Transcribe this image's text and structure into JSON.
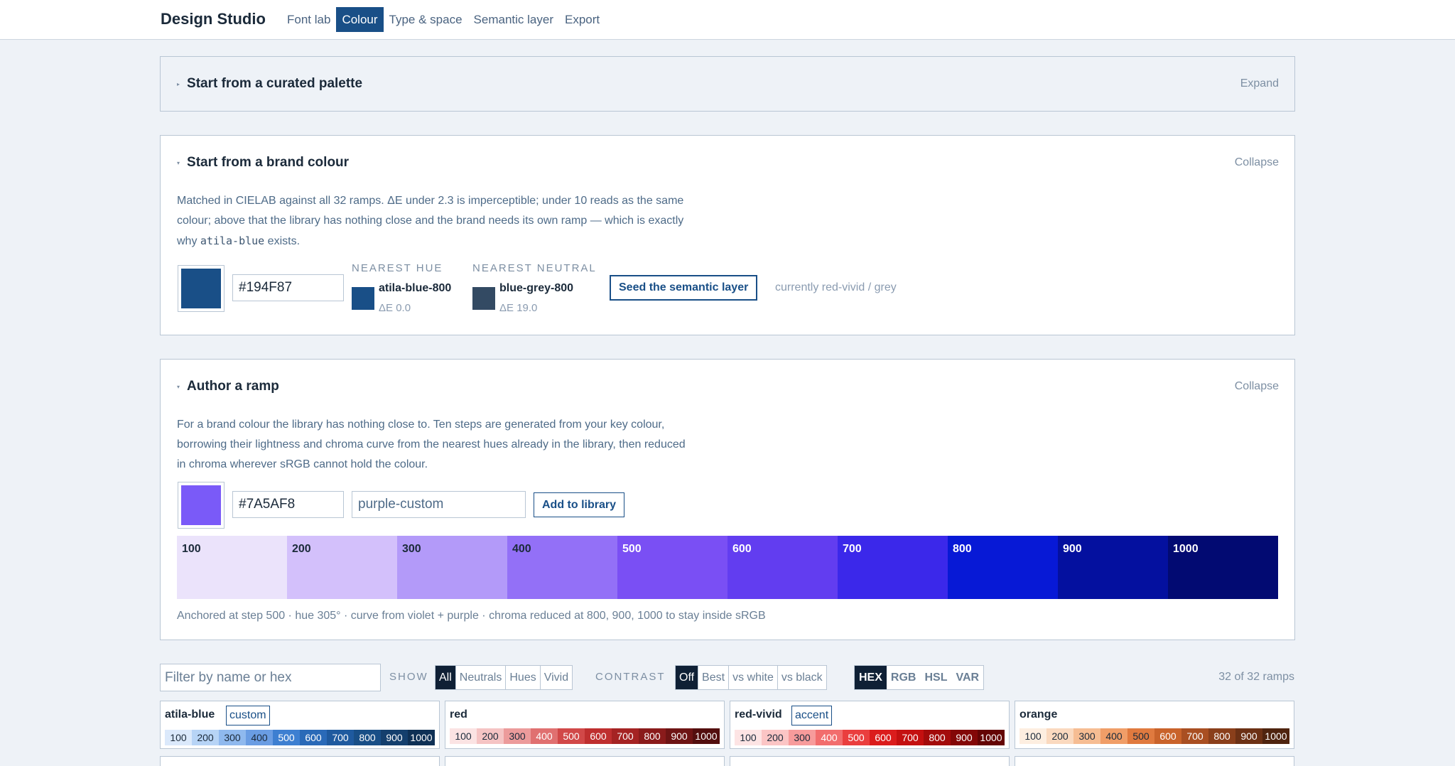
{
  "app": {
    "title": "Design Studio"
  },
  "nav": [
    {
      "label": "Font lab",
      "active": false
    },
    {
      "label": "Colour",
      "active": true
    },
    {
      "label": "Type & space",
      "active": false
    },
    {
      "label": "Semantic layer",
      "active": false
    },
    {
      "label": "Export",
      "active": false
    }
  ],
  "curated": {
    "title": "Start from a curated palette",
    "toggle": "Expand"
  },
  "brand": {
    "title": "Start from a brand colour",
    "toggle": "Collapse",
    "desc_1": "Matched in CIELAB against all 32 ramps. ΔE under 2.3 is imperceptible; under 10 reads as the same colour; above that the library has nothing close and the brand needs its own ramp — which is exactly why ",
    "desc_code": "atila-blue",
    "desc_2": " exists.",
    "hex": "#194F87",
    "nearest_hue_label": "NEAREST HUE",
    "nearest_hue_name": "atila-blue-800",
    "nearest_hue_de": "ΔE 0.0",
    "nearest_hue_color": "#194f87",
    "nearest_neutral_label": "NEAREST NEUTRAL",
    "nearest_neutral_name": "blue-grey-800",
    "nearest_neutral_de": "ΔE 19.0",
    "nearest_neutral_color": "#334a63",
    "seed_button": "Seed the semantic layer",
    "current": "currently red-vivid / grey"
  },
  "author": {
    "title": "Author a ramp",
    "toggle": "Collapse",
    "desc": "For a brand colour the library has nothing close to. Ten steps are generated from your key colour, borrowing their lightness and chroma curve from the nearest hues already in the library, then reduced in chroma wherever sRGB cannot hold the colour.",
    "hex": "#7A5AF8",
    "name": "purple-custom",
    "add_button": "Add to library",
    "steps": [
      {
        "label": "100",
        "color": "#ebe3fb",
        "text": "#1b2a3a"
      },
      {
        "label": "200",
        "color": "#d3c0fb",
        "text": "#1b2a3a"
      },
      {
        "label": "300",
        "color": "#b39af9",
        "text": "#1b2a3a"
      },
      {
        "label": "400",
        "color": "#9370f7",
        "text": "#1b2a3a"
      },
      {
        "label": "500",
        "color": "#7a4ff4",
        "text": "#ffffff"
      },
      {
        "label": "600",
        "color": "#623df0",
        "text": "#ffffff"
      },
      {
        "label": "700",
        "color": "#3b28ea",
        "text": "#ffffff"
      },
      {
        "label": "800",
        "color": "#0719d6",
        "text": "#ffffff"
      },
      {
        "label": "900",
        "color": "#04109f",
        "text": "#ffffff"
      },
      {
        "label": "1000",
        "color": "#020a72",
        "text": "#ffffff"
      }
    ],
    "anchored": "Anchored at step 500 · hue 305° · curve from violet + purple · chroma reduced at 800, 900, 1000 to stay inside sRGB"
  },
  "library": {
    "filter_placeholder": "Filter by name or hex",
    "show_label": "SHOW",
    "show_options": [
      "All",
      "Neutrals",
      "Hues",
      "Vivid"
    ],
    "contrast_label": "CONTRAST",
    "contrast_options": [
      "Off",
      "Best",
      "vs white",
      "vs black"
    ],
    "format_options": [
      "HEX",
      "RGB",
      "HSL",
      "VAR"
    ],
    "count": "32 of 32 ramps",
    "cards": [
      {
        "name": "atila-blue",
        "tag": "custom",
        "steps": [
          "100",
          "200",
          "300",
          "400",
          "500",
          "600",
          "700",
          "800",
          "900",
          "1000"
        ],
        "colors": [
          "#dbe9fb",
          "#b7d4f6",
          "#8fb9ee",
          "#6a9de3",
          "#3d7fd1",
          "#2a6ab8",
          "#1f5a9f",
          "#194f87",
          "#143f6d",
          "#0e3055"
        ],
        "texts": [
          "#1b2a3a",
          "#1b2a3a",
          "#1b2a3a",
          "#1b2a3a",
          "#ffffff",
          "#ffffff",
          "#ffffff",
          "#ffffff",
          "#ffffff",
          "#ffffff"
        ]
      },
      {
        "name": "red",
        "tag": "",
        "steps": [
          "100",
          "200",
          "300",
          "400",
          "500",
          "600",
          "700",
          "800",
          "900",
          "1000"
        ],
        "colors": [
          "#fbe3e3",
          "#f5c4c4",
          "#ec9b9b",
          "#e07070",
          "#d14848",
          "#bf2f2f",
          "#a52323",
          "#8a1b1b",
          "#6e1414",
          "#530e0e"
        ],
        "texts": [
          "#1b2a3a",
          "#1b2a3a",
          "#1b2a3a",
          "#ffffff",
          "#ffffff",
          "#ffffff",
          "#ffffff",
          "#ffffff",
          "#ffffff",
          "#ffffff"
        ]
      },
      {
        "name": "red-vivid",
        "tag": "accent",
        "steps": [
          "100",
          "200",
          "300",
          "400",
          "500",
          "600",
          "700",
          "800",
          "900",
          "1000"
        ],
        "colors": [
          "#fde4e4",
          "#fbc5c5",
          "#f79b9b",
          "#f26d6d",
          "#ea3e3e",
          "#db1c1c",
          "#c41010",
          "#a30b0b",
          "#830707",
          "#640404"
        ],
        "texts": [
          "#1b2a3a",
          "#1b2a3a",
          "#1b2a3a",
          "#ffffff",
          "#ffffff",
          "#ffffff",
          "#ffffff",
          "#ffffff",
          "#ffffff",
          "#ffffff"
        ]
      },
      {
        "name": "orange",
        "tag": "",
        "steps": [
          "100",
          "200",
          "300",
          "400",
          "500",
          "600",
          "700",
          "800",
          "900",
          "1000"
        ],
        "colors": [
          "#fdeee0",
          "#fad9bf",
          "#f6bd93",
          "#f09e68",
          "#e07a3f",
          "#c9632b",
          "#a94f22",
          "#8a3f1b",
          "#6c3115",
          "#4f240f"
        ],
        "texts": [
          "#1b2a3a",
          "#1b2a3a",
          "#1b2a3a",
          "#1b2a3a",
          "#1b2a3a",
          "#ffffff",
          "#ffffff",
          "#ffffff",
          "#ffffff",
          "#ffffff"
        ]
      }
    ]
  }
}
